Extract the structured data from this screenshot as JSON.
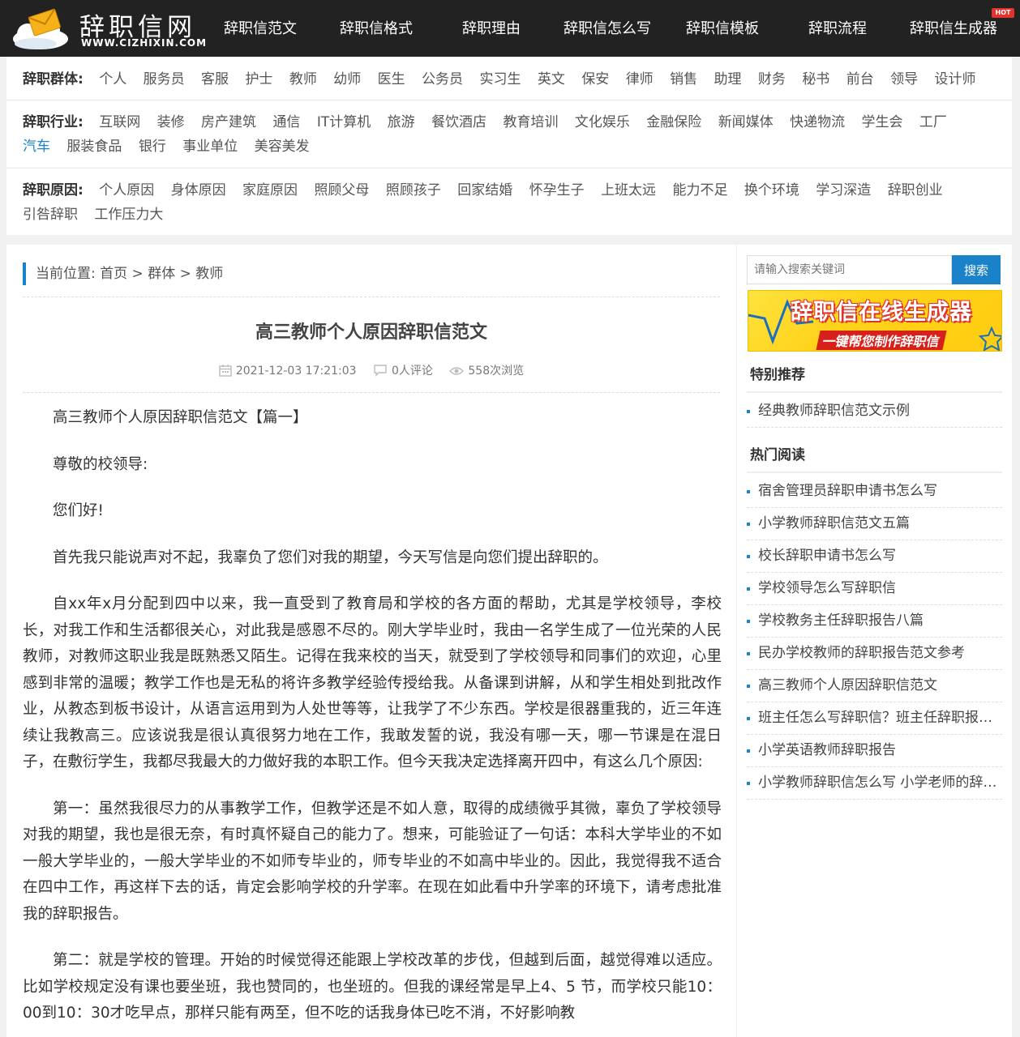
{
  "logo": {
    "title": "辞职信网",
    "url": "WWW.CIZHIXIN.COM"
  },
  "nav": {
    "items": [
      "辞职信范文",
      "辞职信格式",
      "辞职理由",
      "辞职信怎么写",
      "辞职信模板",
      "辞职流程",
      "辞职信生成器"
    ],
    "hot_badge": "HOT"
  },
  "categories": {
    "groups": {
      "label": "辞职群体:",
      "items": [
        "个人",
        "服务员",
        "客服",
        "护士",
        "教师",
        "幼师",
        "医生",
        "公务员",
        "实习生",
        "英文",
        "保安",
        "律师",
        "销售",
        "助理",
        "财务",
        "秘书",
        "前台",
        "领导",
        "设计师"
      ]
    },
    "industries": {
      "label": "辞职行业:",
      "row1": [
        "互联网",
        "装修",
        "房产建筑",
        "通信",
        "IT计算机",
        "旅游",
        "餐饮酒店",
        "教育培训",
        "文化娱乐",
        "金融保险",
        "新闻媒体",
        "快递物流",
        "学生会",
        "工厂"
      ],
      "row2": [
        "汽车",
        "服装食品",
        "银行",
        "事业单位",
        "美容美发"
      ]
    },
    "reasons": {
      "label": "辞职原因:",
      "row1": [
        "个人原因",
        "身体原因",
        "家庭原因",
        "照顾父母",
        "照顾孩子",
        "回家结婚",
        "怀孕生子",
        "上班太远",
        "能力不足",
        "换个环境",
        "学习深造",
        "辞职创业"
      ],
      "row2": [
        "引咎辞职",
        "工作压力大"
      ]
    }
  },
  "breadcrumb": {
    "prefix": "当前位置:",
    "home": "首页",
    "sep": ">",
    "group": "群体",
    "current": "教师"
  },
  "article": {
    "title": "高三教师个人原因辞职信范文",
    "date": "2021-12-03 17:21:03",
    "comments": "0人评论",
    "views": "558次浏览",
    "paragraphs": [
      "高三教师个人原因辞职信范文【篇一】",
      "尊敬的校领导:",
      "您们好!",
      "首先我只能说声对不起，我辜负了您们对我的期望，今天写信是向您们提出辞职的。",
      "自xx年x月分配到四中以来，我一直受到了教育局和学校的各方面的帮助，尤其是学校领导，李校长，对我工作和生活都很关心，对此我是感恩不尽的。刚大学毕业时，我由一名学生成了一位光荣的人民教师，对教师这职业我是既熟悉又陌生。记得在我来校的当天，就受到了学校领导和同事们的欢迎，心里感到非常的温暖；教学工作也是无私的将许多教学经验传授给我。从备课到讲解，从和学生相处到批改作业，从教态到板书设计，从语言运用到为人处世等等，让我学了不少东西。学校是很器重我的，近三年连续让我教高三。应该说我是很认真很努力地在工作，我敢发誓的说，我没有哪一天，哪一节课是在混日子，在敷衍学生，我都尽我最大的力做好我的本职工作。但今天我决定选择离开四中，有这么几个原因:",
      "第一：虽然我很尽力的从事教学工作，但教学还是不如人意，取得的成绩微乎其微，辜负了学校领导对我的期望，我也是很无奈，有时真怀疑自己的能力了。想来，可能验证了一句话：本科大学毕业的不如一般大学毕业的，一般大学毕业的不如师专毕业的，师专毕业的不如高中毕业的。因此，我觉得我不适合在四中工作，再这样下去的话，肯定会影响学校的升学率。在现在如此看中升学率的环境下，请考虑批准我的辞职报告。",
      "第二：就是学校的管理。开始的时候觉得还能跟上学校改革的步伐，但越到后面，越觉得难以适应。比如学校规定没有课也要坐班，我也赞同的，也坐班的。但我的课经常是早上4、5 节，而学校只能10：00到10：30才吃早点，那样只能有两至，但不吃的话我身体已吃不消，不好影响教"
    ]
  },
  "sidebar": {
    "search_placeholder": "请输入搜索关键词",
    "search_button": "搜索",
    "banner": {
      "line1": "辞职信在线生成器",
      "line2": "一键帮您制作辞职信"
    },
    "featured_title": "特别推荐",
    "featured": [
      "经典教师辞职信范文示例"
    ],
    "hot_title": "热门阅读",
    "hot": [
      "宿舍管理员辞职申请书怎么写",
      "小学教师辞职信范文五篇",
      "校长辞职申请书怎么写",
      "学校领导怎么写辞职信",
      "学校教务主任辞职报告八篇",
      "民办学校教师的辞职报告范文参考",
      "高三教师个人原因辞职信范文",
      "班主任怎么写辞职信？班主任辞职报告范文",
      "小学英语教师辞职报告",
      "小学教师辞职信怎么写 小学老师的辞职信范文"
    ]
  },
  "colors": {
    "accent": "#1a82c8",
    "topbar": "#222222",
    "hot": "#e5322d"
  }
}
